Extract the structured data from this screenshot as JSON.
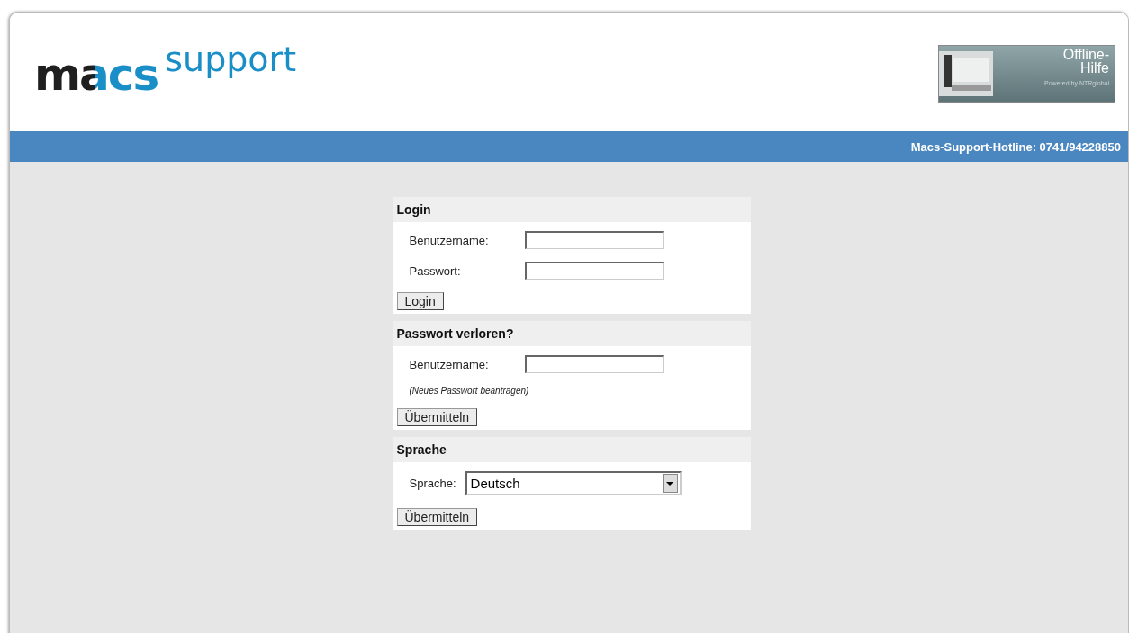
{
  "logo": {
    "brand": "macs",
    "product": "support"
  },
  "help_banner": {
    "title_line_1": "Offline-",
    "title_line_2": "Hilfe",
    "subtitle": "Powered by NTRglobal"
  },
  "hotline": "Macs-Support-Hotline: 0741/94228850",
  "sections": [
    {
      "title": "Login",
      "rows": [
        {
          "kind": "field",
          "label": "Benutzername:"
        },
        {
          "kind": "field",
          "label": "Passwort:"
        }
      ],
      "button": "Login"
    },
    {
      "title": "Passwort verloren?",
      "rows": [
        {
          "kind": "field",
          "label": "Benutzername:"
        },
        {
          "kind": "note",
          "text": "(Neues Passwort beantragen)"
        }
      ],
      "button": "Übermitteln"
    },
    {
      "title": "Sprache",
      "rows": [
        {
          "kind": "select",
          "label": "Sprache:",
          "value": "Deutsch"
        }
      ],
      "button": "Übermitteln"
    }
  ]
}
